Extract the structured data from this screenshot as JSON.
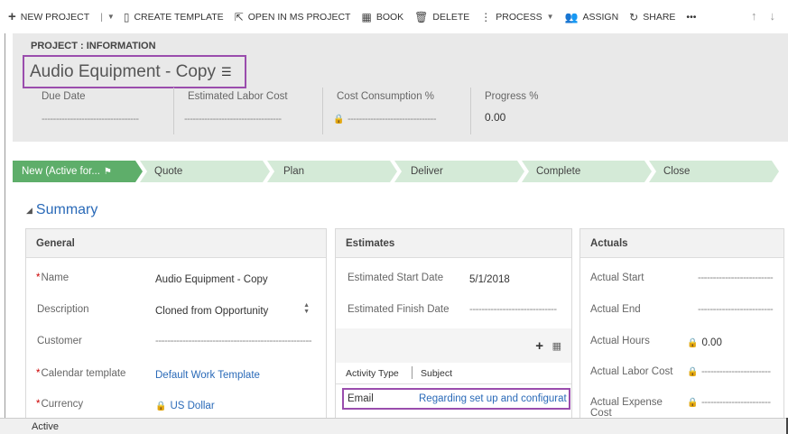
{
  "commands": {
    "new_project": "NEW PROJECT",
    "create_template": "CREATE TEMPLATE",
    "open_ms_project": "OPEN IN MS PROJECT",
    "book": "BOOK",
    "delete": "DELETE",
    "process": "PROCESS",
    "assign": "ASSIGN",
    "share": "SHARE",
    "more": "•••"
  },
  "header": {
    "entity_label": "PROJECT : INFORMATION",
    "title": "Audio Equipment - Copy",
    "fields": [
      {
        "label": "Due Date",
        "value": "----------------------------------"
      },
      {
        "label": "Estimated Labor Cost",
        "value": "----------------------------------"
      },
      {
        "label": "Cost Consumption %",
        "value": "-------------------------------"
      },
      {
        "label": "Progress %",
        "value": "0.00"
      }
    ]
  },
  "process_stages": [
    {
      "label": "New (Active for...",
      "active": true
    },
    {
      "label": "Quote",
      "active": false
    },
    {
      "label": "Plan",
      "active": false
    },
    {
      "label": "Deliver",
      "active": false
    },
    {
      "label": "Complete",
      "active": false
    },
    {
      "label": "Close",
      "active": false
    }
  ],
  "summary_label": "Summary",
  "general": {
    "title": "General",
    "name_label": "Name",
    "name_value": "Audio Equipment - Copy",
    "description_label": "Description",
    "description_value": "Cloned from Opportunity",
    "customer_label": "Customer",
    "customer_value": "----------------------------------------------------",
    "calendar_label": "Calendar template",
    "calendar_value": "Default Work Template",
    "currency_label": "Currency",
    "currency_value": "US Dollar"
  },
  "estimates": {
    "title": "Estimates",
    "start_label": "Estimated Start Date",
    "start_value": "5/1/2018",
    "finish_label": "Estimated Finish Date",
    "finish_value": "-----------------------------",
    "col_activity_type": "Activity Type",
    "col_subject": "Subject",
    "row_activity_type": "Email",
    "row_subject": "Regarding set up and configurat"
  },
  "actuals": {
    "title": "Actuals",
    "start_label": "Actual Start",
    "start_value": "-------------------------",
    "end_label": "Actual End",
    "end_value": "-------------------------",
    "hours_label": "Actual Hours",
    "hours_value": "0.00",
    "labor_label": "Actual Labor Cost",
    "labor_value": "-----------------------",
    "expense_label": "Actual Expense Cost",
    "expense_value": "-----------------------"
  },
  "status": "Active"
}
